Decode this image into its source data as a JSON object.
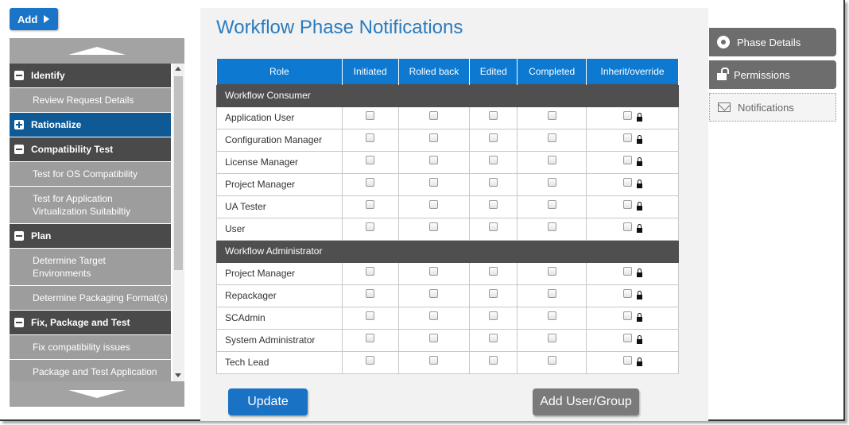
{
  "toolbar": {
    "add_label": "Add"
  },
  "nav": {
    "items": [
      {
        "label": "Identify",
        "kind": "group",
        "expanded": true
      },
      {
        "label": "Review Request Details",
        "kind": "sub"
      },
      {
        "label": "Rationalize",
        "kind": "group",
        "expanded": false,
        "active": true
      },
      {
        "label": "Compatibility Test",
        "kind": "group",
        "expanded": true
      },
      {
        "label": "Test for OS Compatibility",
        "kind": "sub"
      },
      {
        "label_line1": "Test for Application",
        "label_line2": "Virtualization Suitabiltiy",
        "kind": "sub"
      },
      {
        "label": "Plan",
        "kind": "group",
        "expanded": true
      },
      {
        "label_line1": "Determine Target",
        "label_line2": "Environments",
        "kind": "sub"
      },
      {
        "label": "Determine Packaging Format(s)",
        "kind": "sub"
      },
      {
        "label": "Fix, Package and Test",
        "kind": "group",
        "expanded": true
      },
      {
        "label": "Fix compatibility issues",
        "kind": "sub"
      },
      {
        "label": "Package and Test Application",
        "kind": "sub"
      }
    ]
  },
  "main": {
    "title": "Workflow Phase Notifications",
    "columns": [
      "Role",
      "Initiated",
      "Rolled back",
      "Edited",
      "Completed",
      "Inherit/override"
    ],
    "groups": [
      {
        "name": "Workflow Consumer",
        "roles": [
          "Application User",
          "Configuration Manager",
          "License Manager",
          "Project Manager",
          "UA Tester",
          "User"
        ]
      },
      {
        "name": "Workflow Administrator",
        "roles": [
          "Project Manager",
          "Repackager",
          "SCAdmin",
          "System Administrator",
          "Tech Lead"
        ]
      }
    ],
    "update_label": "Update",
    "add_user_group_label": "Add User/Group"
  },
  "right_tabs": {
    "phase_details": "Phase Details",
    "permissions": "Permissions",
    "notifications": "Notifications"
  },
  "colors": {
    "accent": "#0d79d0",
    "nav_group": "#4a4a4a",
    "nav_active": "#0f5a95",
    "nav_sub": "#9d9d9d"
  }
}
